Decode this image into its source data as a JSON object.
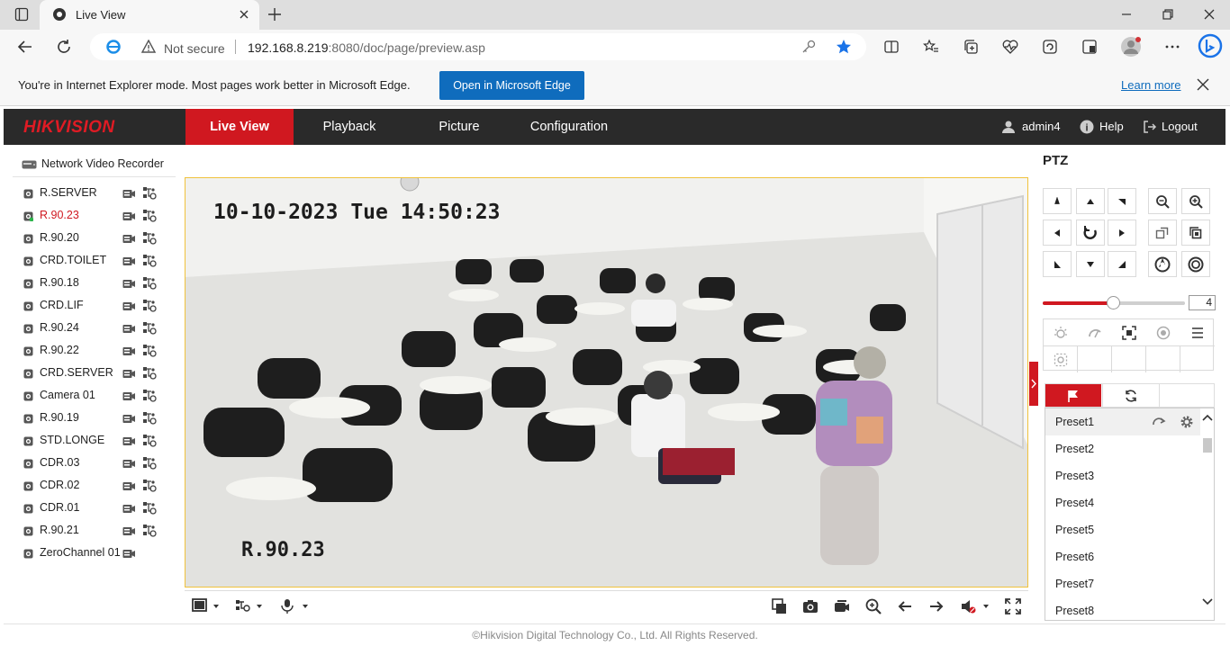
{
  "browser": {
    "tab_title": "Live View",
    "security_label": "Not secure",
    "url_host": "192.168.8.219",
    "url_rest": ":8080/doc/page/preview.asp",
    "ie_message": "You're in Internet Explorer mode. Most pages work better in Microsoft Edge.",
    "open_edge_label": "Open in Microsoft Edge",
    "learn_more_label": "Learn more"
  },
  "header": {
    "logo": "HIKVISION",
    "nav": [
      "Live View",
      "Playback",
      "Picture",
      "Configuration"
    ],
    "active_nav": "Live View",
    "user": "admin4",
    "help": "Help",
    "logout": "Logout"
  },
  "tree": {
    "root_label": "Network Video Recorder",
    "cameras": [
      {
        "name": "R.SERVER"
      },
      {
        "name": "R.90.23",
        "selected": true
      },
      {
        "name": "R.90.20"
      },
      {
        "name": "CRD.TOILET"
      },
      {
        "name": "R.90.18"
      },
      {
        "name": "CRD.LIF"
      },
      {
        "name": "R.90.24"
      },
      {
        "name": "R.90.22"
      },
      {
        "name": "CRD.SERVER"
      },
      {
        "name": "Camera 01"
      },
      {
        "name": "R.90.19"
      },
      {
        "name": "STD.LONGE"
      },
      {
        "name": "CDR.03"
      },
      {
        "name": "CDR.02"
      },
      {
        "name": "CDR.01"
      },
      {
        "name": "R.90.21"
      },
      {
        "name": "ZeroChannel 01"
      }
    ]
  },
  "video": {
    "osd_time": "10-10-2023 Tue 14:50:23",
    "osd_name": "R.90.23"
  },
  "ptz": {
    "title": "PTZ",
    "speed": "4",
    "speed_fraction": 0.5,
    "presets": [
      "Preset1",
      "Preset2",
      "Preset3",
      "Preset4",
      "Preset5",
      "Preset6",
      "Preset7",
      "Preset8"
    ]
  },
  "footer": {
    "copyright": "©Hikvision Digital Technology Co., Ltd. All Rights Reserved."
  },
  "colors": {
    "accent_red": "#d01820",
    "header_bg": "#2a2a2a",
    "edge_blue": "#0f6cbd",
    "video_border": "#f0c23c"
  }
}
